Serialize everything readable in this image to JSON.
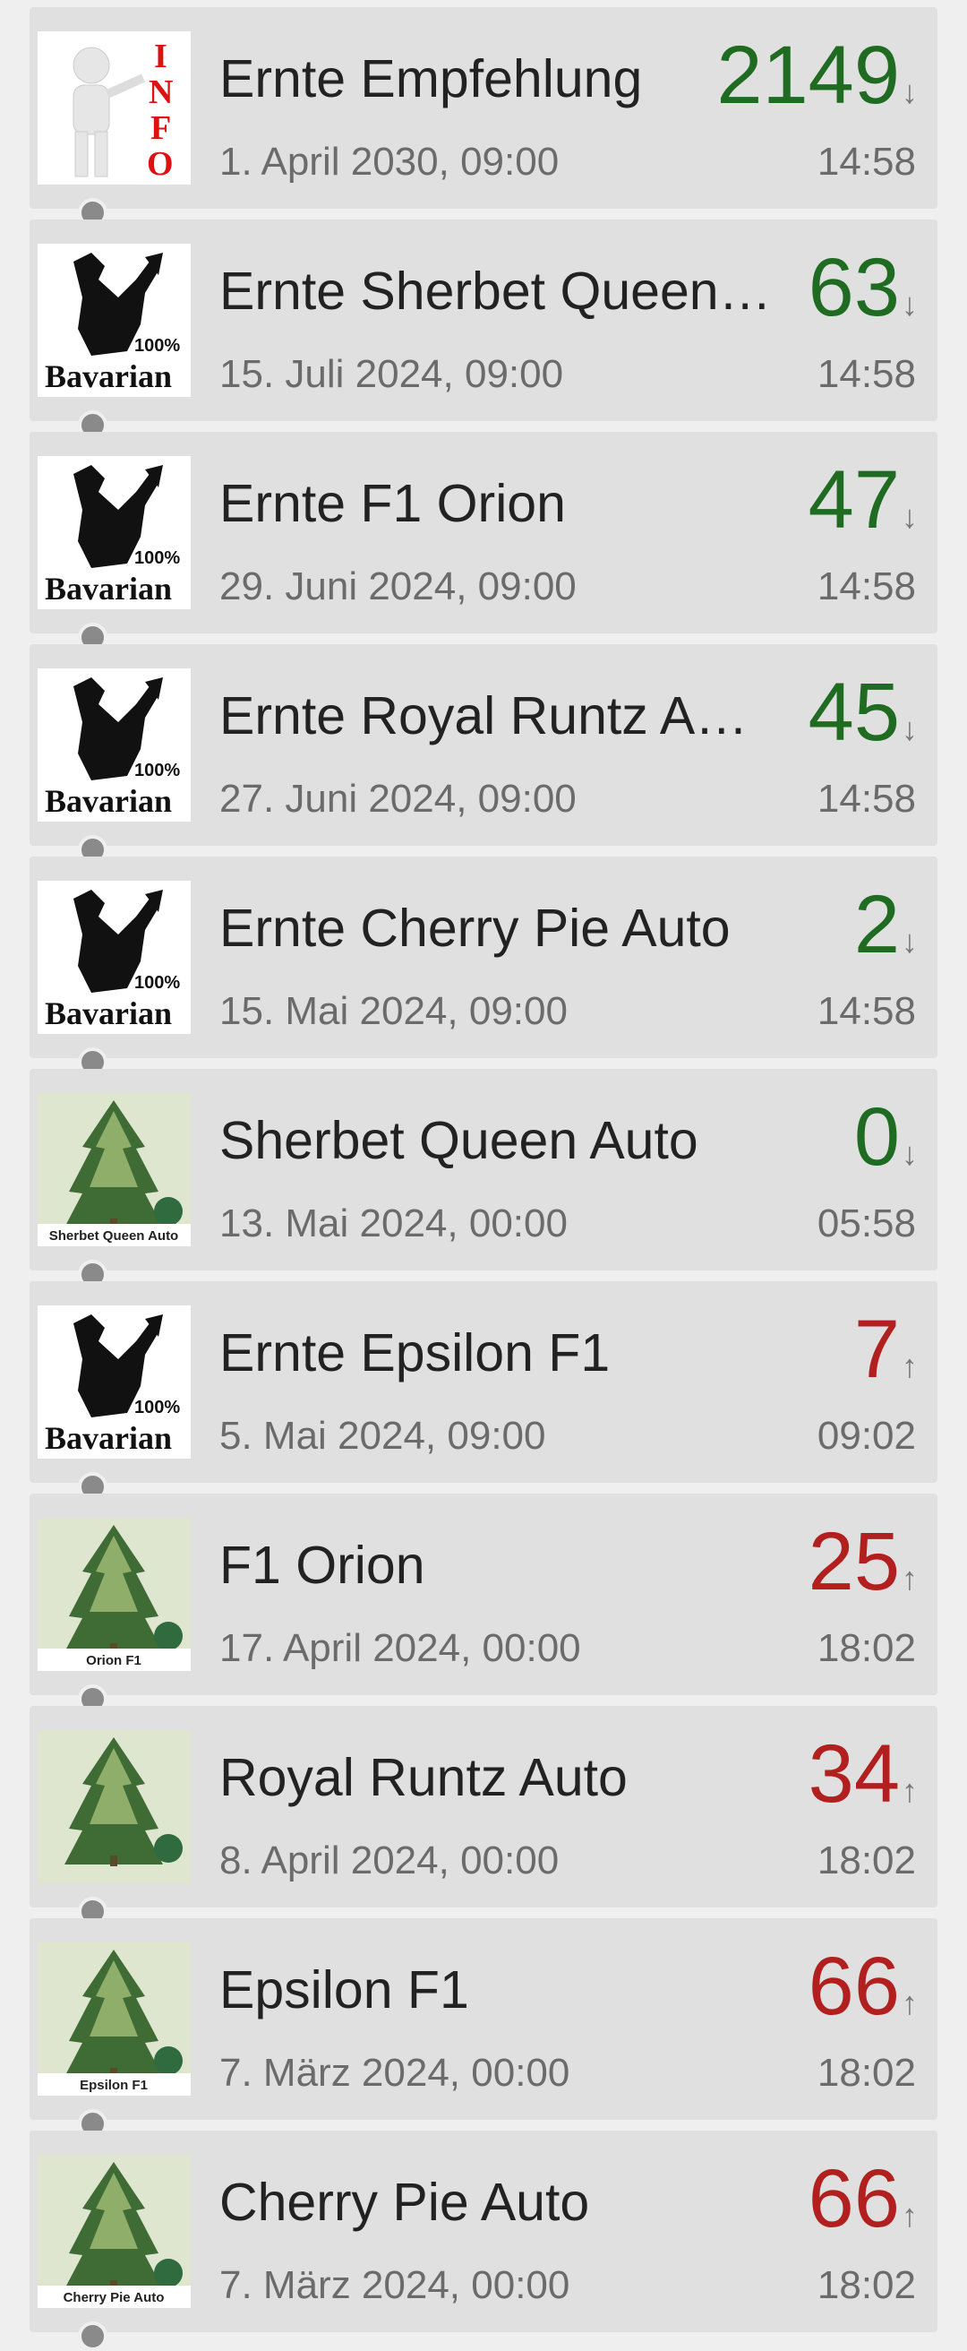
{
  "colors": {
    "down": "#1f6b22",
    "up": "#b21f1f"
  },
  "items": [
    {
      "title": "Ernte Empfehlung",
      "date": "1. April 2030, 09:00",
      "count": "2149",
      "arrow": "↓",
      "time": "14:58",
      "icon": "info-man-icon",
      "trend": "down"
    },
    {
      "title": "Ernte Sherbet Queen…",
      "date": "15. Juli 2024, 09:00",
      "count": "63",
      "arrow": "↓",
      "time": "14:58",
      "icon": "bavarian-logo-icon",
      "trend": "down"
    },
    {
      "title": "Ernte F1 Orion",
      "date": "29. Juni 2024, 09:00",
      "count": "47",
      "arrow": "↓",
      "time": "14:58",
      "icon": "bavarian-logo-icon",
      "trend": "down"
    },
    {
      "title": "Ernte Royal Runtz A…",
      "date": "27. Juni 2024, 09:00",
      "count": "45",
      "arrow": "↓",
      "time": "14:58",
      "icon": "bavarian-logo-icon",
      "trend": "down"
    },
    {
      "title": "Ernte Cherry Pie Auto",
      "date": "15. Mai 2024, 09:00",
      "count": "2",
      "arrow": "↓",
      "time": "14:58",
      "icon": "bavarian-logo-icon",
      "trend": "down"
    },
    {
      "title": "Sherbet Queen Auto",
      "date": "13. Mai 2024, 00:00",
      "count": "0",
      "arrow": "↓",
      "time": "05:58",
      "icon": "plant-photo-icon",
      "trend": "down",
      "caption": "Sherbet Queen Auto"
    },
    {
      "title": "Ernte Epsilon F1",
      "date": "5. Mai 2024, 09:00",
      "count": "7",
      "arrow": "↑",
      "time": "09:02",
      "icon": "bavarian-logo-icon",
      "trend": "up"
    },
    {
      "title": "F1 Orion",
      "date": "17. April 2024, 00:00",
      "count": "25",
      "arrow": "↑",
      "time": "18:02",
      "icon": "plant-photo-icon",
      "trend": "up",
      "caption": "Orion F1"
    },
    {
      "title": "Royal Runtz Auto",
      "date": "8. April 2024, 00:00",
      "count": "34",
      "arrow": "↑",
      "time": "18:02",
      "icon": "plant-photo-icon",
      "trend": "up",
      "caption": ""
    },
    {
      "title": "Epsilon F1",
      "date": "7. März 2024, 00:00",
      "count": "66",
      "arrow": "↑",
      "time": "18:02",
      "icon": "plant-photo-icon",
      "trend": "up",
      "caption": "Epsilon F1"
    },
    {
      "title": "Cherry Pie Auto",
      "date": "7. März 2024, 00:00",
      "count": "66",
      "arrow": "↑",
      "time": "18:02",
      "icon": "plant-photo-icon",
      "trend": "up",
      "caption": "Cherry Pie Auto"
    }
  ]
}
